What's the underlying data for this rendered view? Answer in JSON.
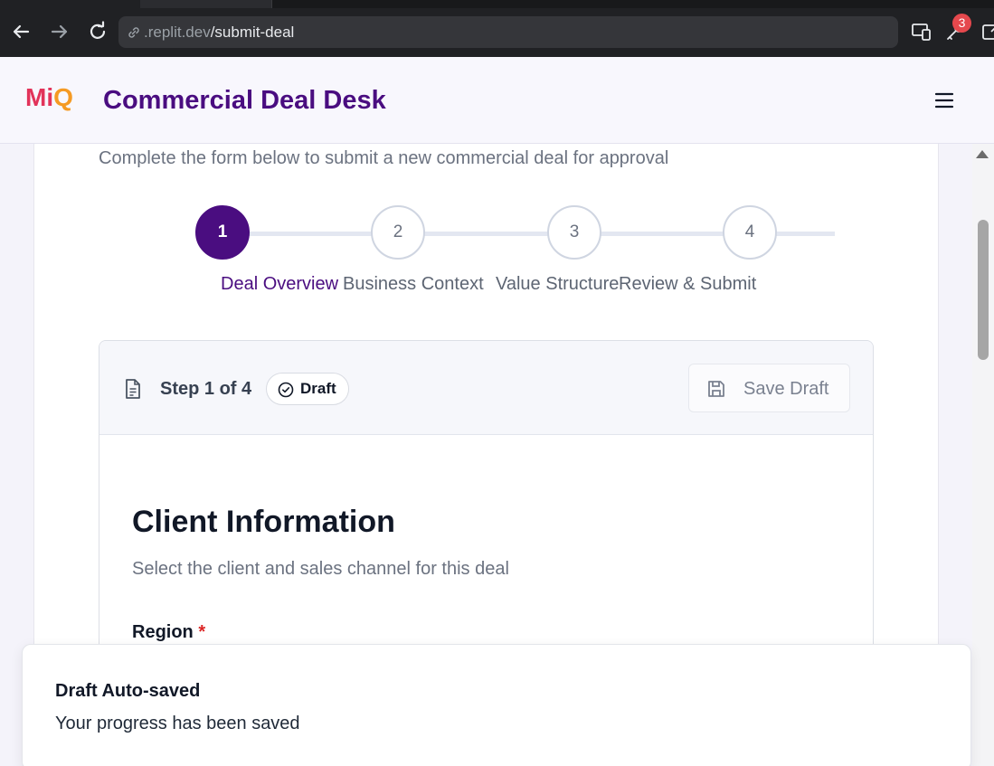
{
  "browser": {
    "url_host": ".replit.dev",
    "url_path": "/submit-deal",
    "extension_badge": "3"
  },
  "header": {
    "logo_text_1": "Mi",
    "logo_text_2": "Q",
    "title": "Commercial Deal Desk"
  },
  "page": {
    "subtitle": "Complete the form below to submit a new commercial deal for approval"
  },
  "stepper": {
    "steps": [
      {
        "number": "1",
        "label": "Deal Overview",
        "active": true
      },
      {
        "number": "2",
        "label": "Business Context",
        "active": false
      },
      {
        "number": "3",
        "label": "Value Structure",
        "active": false
      },
      {
        "number": "4",
        "label": "Review & Submit",
        "active": false
      }
    ]
  },
  "form": {
    "step_indicator": "Step 1 of 4",
    "status_badge": "Draft",
    "save_draft_label": "Save Draft",
    "section_title": "Client Information",
    "section_description": "Select the client and sales channel for this deal",
    "region_label": "Region",
    "required_marker": "*"
  },
  "toast": {
    "title": "Draft Auto-saved",
    "message": "Your progress has been saved"
  },
  "colors": {
    "brand_purple": "#4a0d80",
    "logo_red": "#e2335a",
    "logo_orange": "#f59a23",
    "required_red": "#dc2626",
    "badge_red": "#e5484d"
  }
}
